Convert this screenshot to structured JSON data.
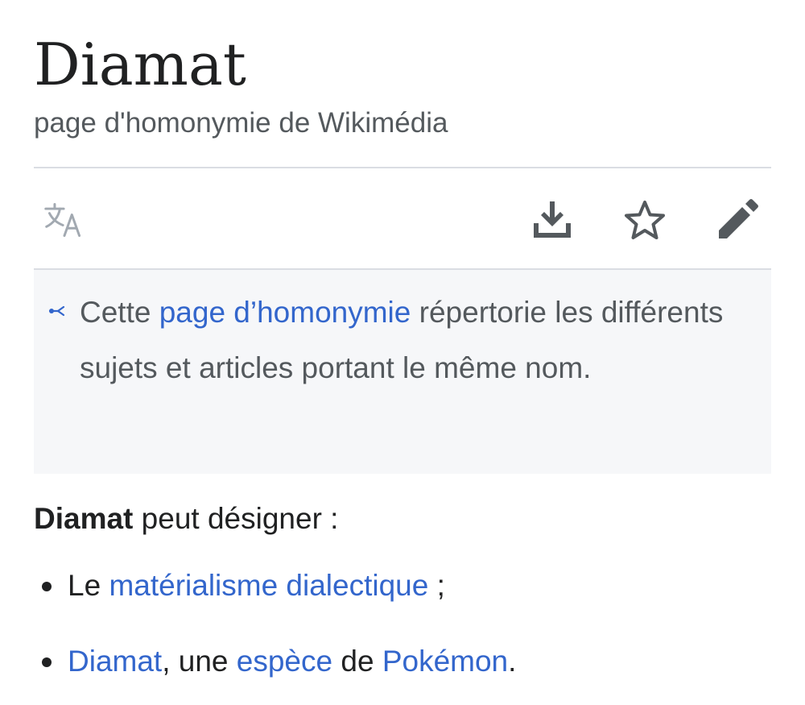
{
  "page": {
    "title": "Diamat",
    "subtitle": "page d'homonymie de Wikimédia"
  },
  "toolbar": {
    "language_icon": "translate-icon",
    "download_icon": "download-icon",
    "watch_icon": "star-icon",
    "edit_icon": "pencil-icon"
  },
  "hatnote": {
    "icon": "disambiguation-icon",
    "text_before": "Cette ",
    "link": "page d’homonymie",
    "text_after": " répertorie les différents sujets et articles portant le même nom."
  },
  "content": {
    "intro_bold": "Diamat",
    "intro_rest": " peut désigner :",
    "items": [
      {
        "before": "Le ",
        "link": "matérialisme dialectique",
        "after": " ;"
      },
      {
        "link1": "Diamat",
        "mid1": ", une ",
        "link2": "espèce",
        "mid2": " de ",
        "link3": "Pokémon",
        "after": "."
      }
    ]
  },
  "colors": {
    "link": "#3366cc",
    "text": "#202122",
    "muted": "#54595d",
    "hatnote_bg": "#f6f7f9",
    "divider": "#dadde3"
  }
}
